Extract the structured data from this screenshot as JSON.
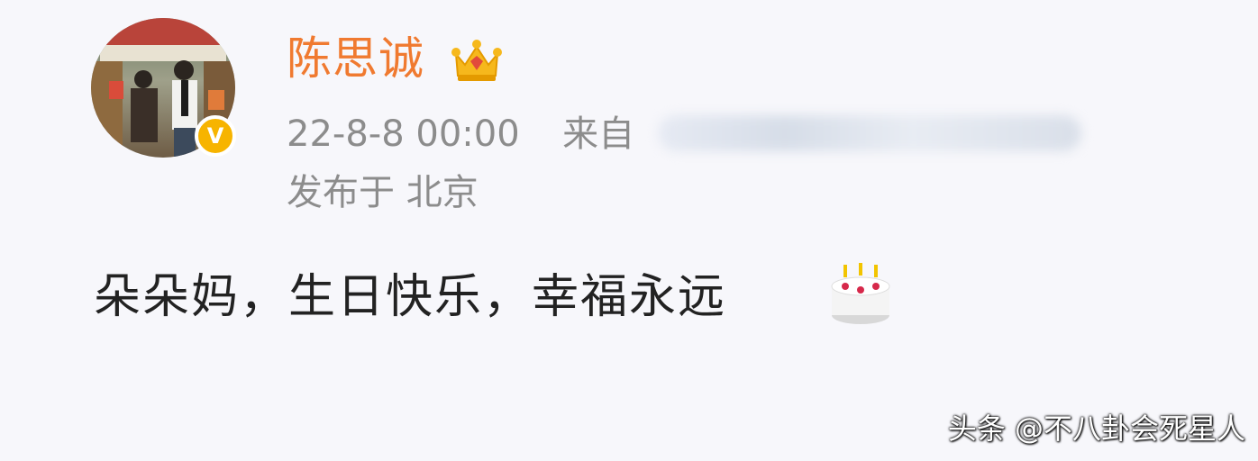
{
  "post": {
    "author_name": "陈思诚",
    "author_badge_icon": "crown-icon",
    "verified_icon": "verified-v-icon",
    "timestamp": "22-8-8 00:00",
    "source_prefix": "来自",
    "location_label": "发布于 北京",
    "text": "朵朵妈，生日快乐，幸福永远",
    "emoji_icon": "birthday-cake-icon"
  },
  "watermark": "头条 @不八卦会死星人",
  "colors": {
    "name": "#f07a30",
    "meta": "#8c8c8c",
    "text": "#222222",
    "verified": "#f7b400",
    "background": "#f7f7fb"
  }
}
